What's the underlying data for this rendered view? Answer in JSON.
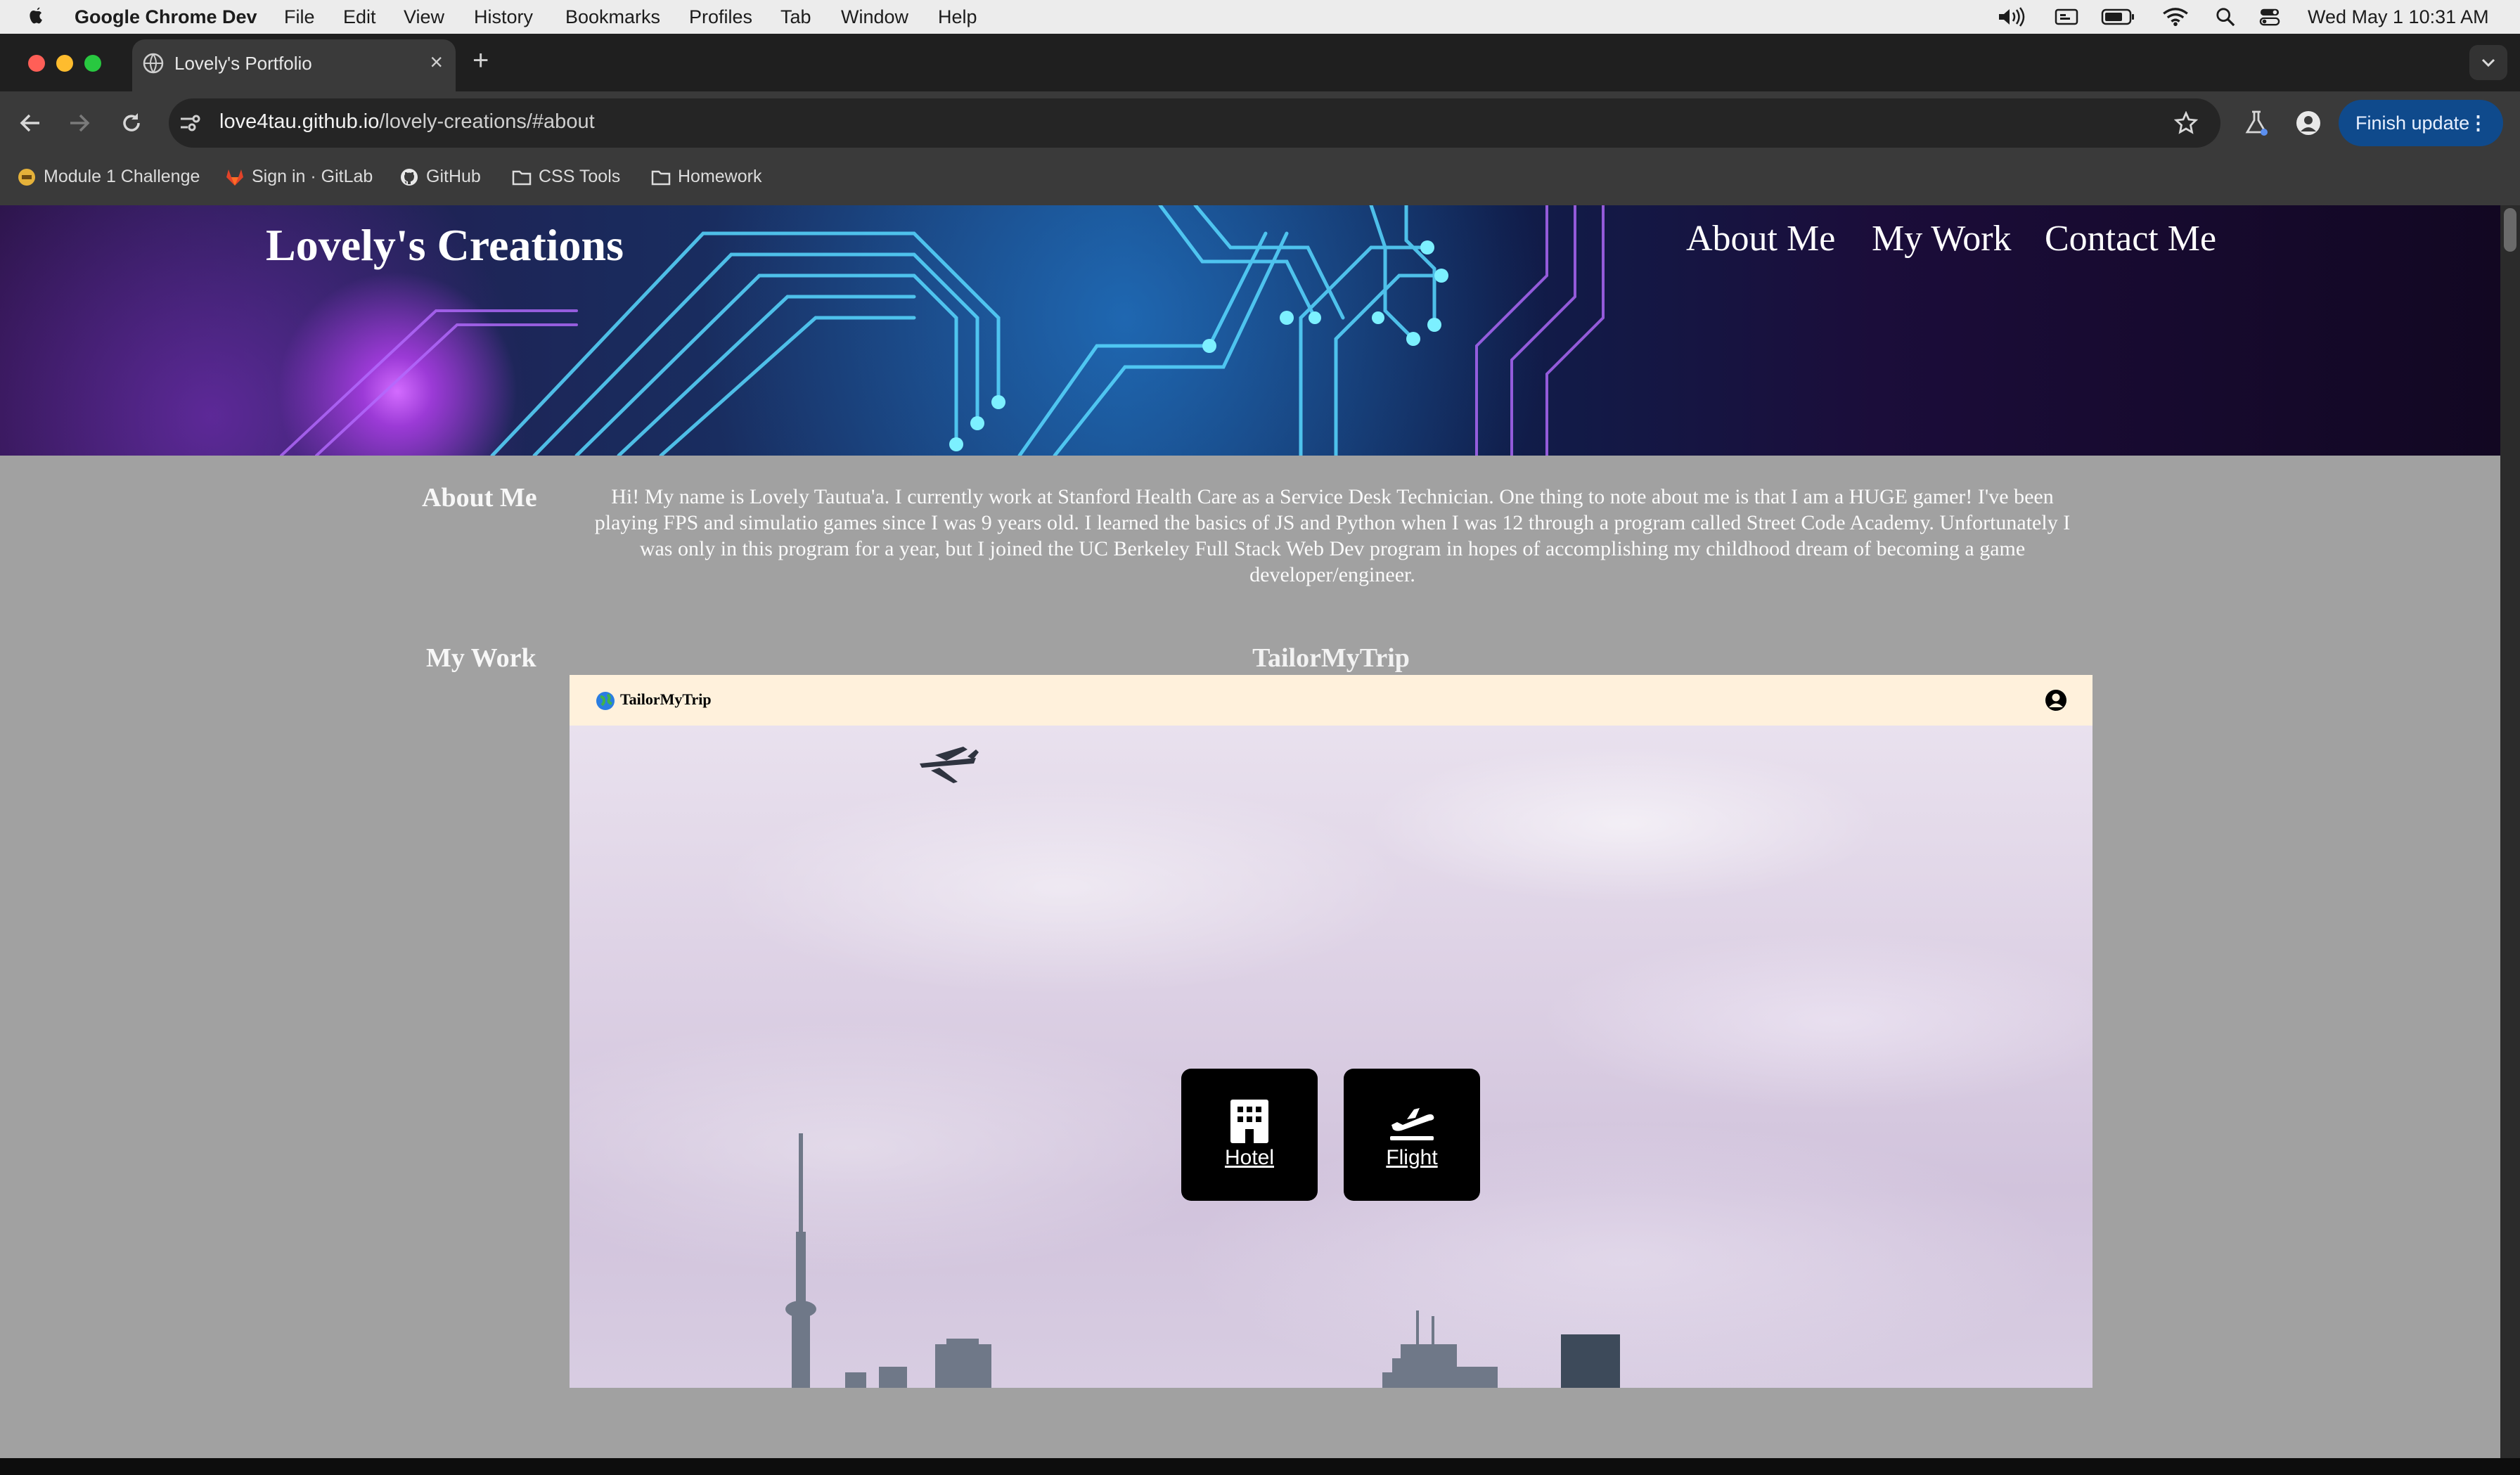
{
  "menubar": {
    "app_name": "Google Chrome Dev",
    "menus": [
      "File",
      "Edit",
      "View",
      "History",
      "Bookmarks",
      "Profiles",
      "Tab",
      "Window",
      "Help"
    ],
    "datetime": "Wed May 1  10:31 AM"
  },
  "browser": {
    "tab_title": "Lovely's Portfolio",
    "url_host": "love4tau.github.io",
    "url_path": "/lovely-creations/#about",
    "finish_update": "Finish update",
    "bookmarks": [
      "Module 1 Challenge",
      "Sign in · GitLab",
      "GitHub",
      "CSS Tools",
      "Homework"
    ]
  },
  "site": {
    "brand": "Lovely's Creations",
    "nav": [
      "About Me",
      "My Work",
      "Contact Me"
    ],
    "about_heading": "About Me",
    "about_text": "Hi! My name is Lovely Tautua'a. I currently work at Stanford Health Care as a Service Desk Technician. One thing to note about me is that I am a HUGE gamer! I've been playing FPS and simulatio games since I was 9 years old. I learned the basics of JS and Python when I was 12 through a program called Street Code Academy. Unfortunately I was only in this program for a year, but I joined the UC Berkeley Full Stack Web Dev program in hopes of accomplishing my childhood dream of becoming a game developer/engineer.",
    "work_heading": "My Work",
    "project_title": "TailorMyTrip",
    "preview": {
      "logo": "TailorMyTrip",
      "cards": [
        "Hotel",
        "Flight"
      ]
    }
  },
  "colors": {
    "page_bg": "#a1a1a1",
    "preview_nav_bg": "#fff1dc",
    "update_button": "#0f4a8c"
  }
}
